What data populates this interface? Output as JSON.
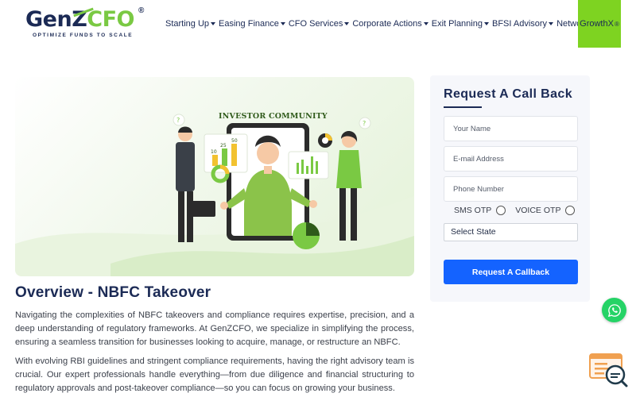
{
  "header": {
    "logo": {
      "text_main": "GenZ",
      "text_accent": "CFO",
      "registered": "®",
      "tagline": "OPTIMIZE FUNDS TO SCALE"
    },
    "nav": [
      {
        "label": "Starting Up",
        "has_dropdown": true
      },
      {
        "label": "Easing Finance",
        "has_dropdown": true
      },
      {
        "label": "CFO Services",
        "has_dropdown": true
      },
      {
        "label": "Corporate Actions",
        "has_dropdown": true
      },
      {
        "label": "Exit Planning",
        "has_dropdown": true
      },
      {
        "label": "BFSI Advisory",
        "has_dropdown": true
      },
      {
        "label": "Network",
        "has_dropdown": true
      }
    ],
    "growthx": {
      "label": "GrowthX",
      "mark": "®"
    },
    "colors": {
      "brand": "#1b2a55",
      "accent": "#7ed321"
    }
  },
  "hero": {
    "caption": "INVESTOR COMMUNITY",
    "bar_values": [
      "10",
      "25",
      "50"
    ],
    "question_mark": "?"
  },
  "overview": {
    "title": "Overview - NBFC Takeover",
    "paragraph_1": "Navigating the complexities of NBFC takeovers and compliance requires expertise, precision, and a deep understanding of regulatory frameworks. At GenZCFO, we specialize in simplifying the process, ensuring a seamless transition for businesses looking to acquire, manage, or restructure an NBFC.",
    "paragraph_2": "With evolving RBI guidelines and stringent compliance requirements, having the right advisory team is crucial. Our expert professionals handle everything—from due diligence and financial structuring to regulatory approvals and post-takeover compliance—so you can focus on growing your business."
  },
  "form": {
    "title": "Request A Call Back",
    "name_placeholder": "Your Name",
    "email_placeholder": "E-mail Address",
    "phone_placeholder": "Phone Number",
    "sms_otp_label": "SMS OTP",
    "voice_otp_label": "VOICE OTP",
    "state_selected": "Select State",
    "submit_label": "Request A Callback",
    "submit_color": "#1463ff"
  },
  "floating": {
    "whatsapp_icon": "whatsapp-icon",
    "chat_icon": "chat-search-icon"
  }
}
